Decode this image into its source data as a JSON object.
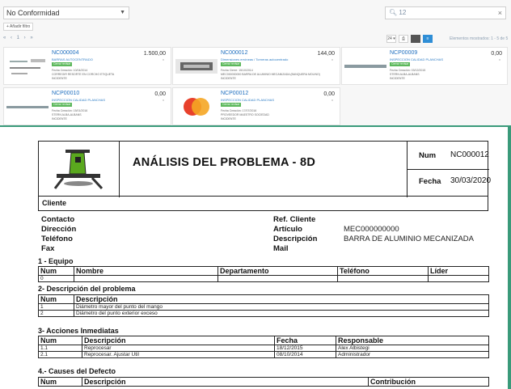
{
  "toolbar": {
    "filter_value": "No Conformidad",
    "search_value": "12",
    "add_filter_label": "+ Añadir filtro",
    "pager_nav": "« ‹ 1 › »",
    "per_page": "24",
    "records_label": "Elementos mostrados: 1 - 5 de 5"
  },
  "cards": [
    {
      "code": "NC000004",
      "amount": "1.500,00",
      "sub": "BARRAS AUTOCENTRADO",
      "badge": "Cerrar revisar",
      "line1": "Fecha Creación: 10/04/2014",
      "line2": "CORREGIR RESORTE EN CORCHO ETIQUETA",
      "line3": "INCIDENTE"
    },
    {
      "code": "NC000012",
      "amount": "144,00",
      "sub": "Dimensiones erróneas / Torneras autocentrado",
      "badge": "Cerrar revisar",
      "line1": "Fecha Cierre: 15/10/2014",
      "line2": "MEC000000000 BARRA DE ALUMINIO MECANIZADA (BANQUERA MOLINO)",
      "line3": "INCIDENTE"
    },
    {
      "code": "NCP00009",
      "amount": "0,00",
      "sub": "INSPECCION CALIDAD PLANCHAS",
      "badge": "Cerrar revisar",
      "line1": "Fecha Creación: 03/12/2015",
      "line2": "STERN ALBA-ALBANS",
      "line3": "INCIDENTE"
    },
    {
      "code": "NCP00010",
      "amount": "0,00",
      "sub": "INSPECCION CALIDAD PLANCHAS",
      "badge": "Cerrar revisar",
      "line1": "Fecha Creación: 15/01/2016",
      "line2": "STERN ALBA-ALBANS",
      "line3": "INCIDENTE"
    },
    {
      "code": "NCP00012",
      "amount": "0,00",
      "sub": "INSPECCION CALIDAD PLANCHAS",
      "badge": "Cerrar revisar",
      "line1": "Fecha Creación: 17/07/2016",
      "line2": "PROVEEDOR MAESTRO SOCIEDAD",
      "line3": "INCIDENTE"
    }
  ],
  "report": {
    "title": "ANÁLISIS DEL PROBLEMA - 8D",
    "num_label": "Num",
    "num_value": "NC000012",
    "fecha_label": "Fecha",
    "fecha_value": "30/03/2020",
    "cliente_label": "Cliente",
    "left_labels": [
      "Contacto",
      "Dirección",
      "Teléfono",
      "Fax"
    ],
    "right_labels": [
      "Ref. Cliente",
      "Artículo",
      "Descripción",
      "Mail"
    ],
    "articulo_value": "MEC000000000",
    "descripcion_value": "BARRA DE ALUMINIO MECANIZADA",
    "equipo": {
      "title": "1 - Equipo",
      "headers": [
        "Num",
        "Nombre",
        "Departamento",
        "Teléfono",
        "Líder"
      ],
      "rows": [
        [
          "0",
          "",
          "",
          "",
          ""
        ]
      ]
    },
    "problema": {
      "title": "2- Descripción del problema",
      "headers": [
        "Num",
        "Descripción"
      ],
      "rows": [
        [
          "1",
          "Diámetro mayor del punto del mango"
        ],
        [
          "2",
          "Diámetro del punto exterior exceso"
        ]
      ]
    },
    "acciones": {
      "title": "3- Acciones Inmediatas",
      "headers": [
        "Num",
        "Descripción",
        "Fecha",
        "Responsable"
      ],
      "rows": [
        [
          "1.1",
          "Reprocesar",
          "18/12/2015",
          "Alex Albistegi"
        ],
        [
          "2.1",
          "Reprocesar. Ajustar Util",
          "08/10/2014",
          "Administrador"
        ]
      ]
    },
    "causas": {
      "title": "4.- Causes del Defecto",
      "headers": [
        "Num",
        "Descripción",
        "Contribución"
      ]
    }
  }
}
